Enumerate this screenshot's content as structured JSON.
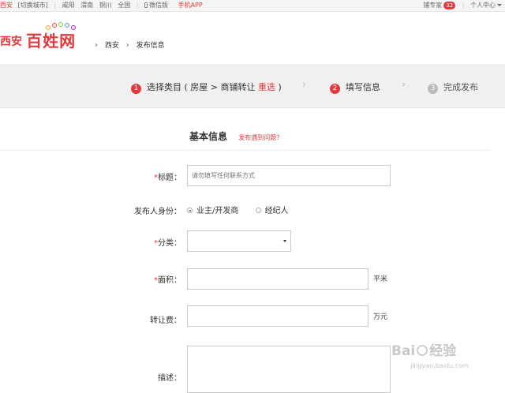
{
  "topbar": {
    "current_city": "西安",
    "switch_city": "[切换城市]",
    "nearby_cities": [
      "咸阳",
      "渭南",
      "铜川",
      "全国"
    ],
    "wechat": "微信版",
    "app": "手机APP",
    "shop_expert": "铺专家",
    "shop_expert_count": "32",
    "user_center": "个人中心"
  },
  "header": {
    "logo_city": "西安",
    "logo_brand": "百姓网",
    "breadcrumb": [
      "西安",
      "发布信息"
    ]
  },
  "steps": {
    "step1_num": "1",
    "step1_text": "选择类目 ( 房屋 > 商铺转让",
    "step1_reselect": "重选",
    "step1_close": ")",
    "step2_num": "2",
    "step2_text": "填写信息",
    "step3_num": "3",
    "step3_text": "完成发布"
  },
  "form": {
    "section_title": "基本信息",
    "help_link": "发布遇到问题？",
    "required_mark": "*",
    "title_label": "标题：",
    "title_placeholder": "请勿填写任何联系方式",
    "publisher_label": "发布人身份：",
    "publisher_options": [
      "业主/开发商",
      "经纪人"
    ],
    "publisher_selected": "业主/开发商",
    "category_label": "分类：",
    "category_value": "",
    "area_label": "面积：",
    "area_unit": "平米",
    "fee_label": "转让费：",
    "fee_unit": "万元",
    "desc_label": "描述："
  },
  "watermark": {
    "brand": "Bai",
    "brand_tail": "经验",
    "url": "jingyan.baidu.com"
  },
  "colors": {
    "accent": "#e4393c",
    "step_bar": "#f0f0f0",
    "inactive": "#bbbbbb"
  }
}
